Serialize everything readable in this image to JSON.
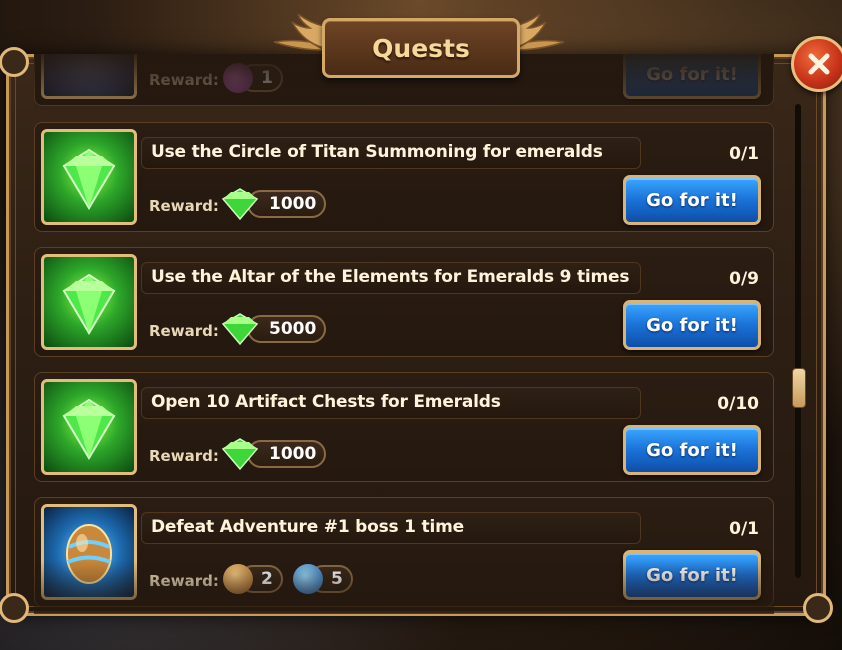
{
  "window": {
    "title": "Quests",
    "close_icon": "close-x-icon"
  },
  "colors": {
    "frame_gold": "#c79a5c",
    "panel_brown": "#2c1e13",
    "button_blue": "#1a72d8",
    "close_red": "#c8341a",
    "text_light": "#fff3dc"
  },
  "reward_label": "Reward:",
  "go_button_label": "Go for it!",
  "quests": [
    {
      "title": "",
      "progress": "",
      "icon": "adventure-token-icon",
      "rewards": [
        {
          "icon": "orb-icon",
          "amount": "1"
        }
      ]
    },
    {
      "title": "Use the Circle of Titan Summoning for emeralds",
      "progress": "0/1",
      "icon": "emerald-icon",
      "rewards": [
        {
          "icon": "emerald-icon",
          "amount": "1000"
        }
      ]
    },
    {
      "title": "Use the Altar of the Elements for Emeralds 9 times",
      "progress": "0/9",
      "icon": "emerald-icon",
      "rewards": [
        {
          "icon": "emerald-icon",
          "amount": "5000"
        }
      ]
    },
    {
      "title": "Open 10 Artifact Chests for Emeralds",
      "progress": "0/10",
      "icon": "emerald-icon",
      "rewards": [
        {
          "icon": "emerald-icon",
          "amount": "1000"
        }
      ]
    },
    {
      "title": "Defeat Adventure #1 boss 1 time",
      "progress": "0/1",
      "icon": "golden-egg-icon",
      "rewards": [
        {
          "icon": "golden-egg-icon",
          "amount": "2"
        },
        {
          "icon": "blue-swirl-orb-icon",
          "amount": "5"
        }
      ]
    }
  ],
  "scroll": {
    "position_fraction": 0.6
  }
}
